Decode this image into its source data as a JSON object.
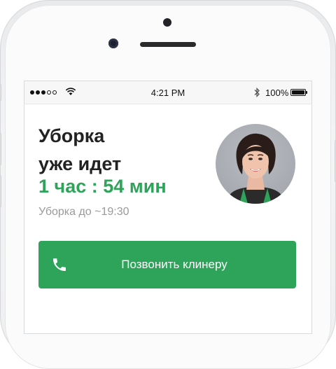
{
  "status_bar": {
    "time": "4:21 PM",
    "battery_percent_label": "100%",
    "battery_level": 1.0,
    "signal_bars_filled": 3,
    "signal_bars_total": 5
  },
  "cleaning": {
    "title": "Уборка уже идет",
    "timer": "1 час : 54 мин",
    "until_text": "Уборка до ~19:30"
  },
  "call_button": {
    "label": "Позвонить клинеру",
    "icon": "phone-icon"
  },
  "avatar": {
    "icon": "cleaner-avatar"
  },
  "colors": {
    "accent_green": "#2ea35a",
    "title_text": "#222222",
    "muted_text": "#9a9a9a"
  }
}
